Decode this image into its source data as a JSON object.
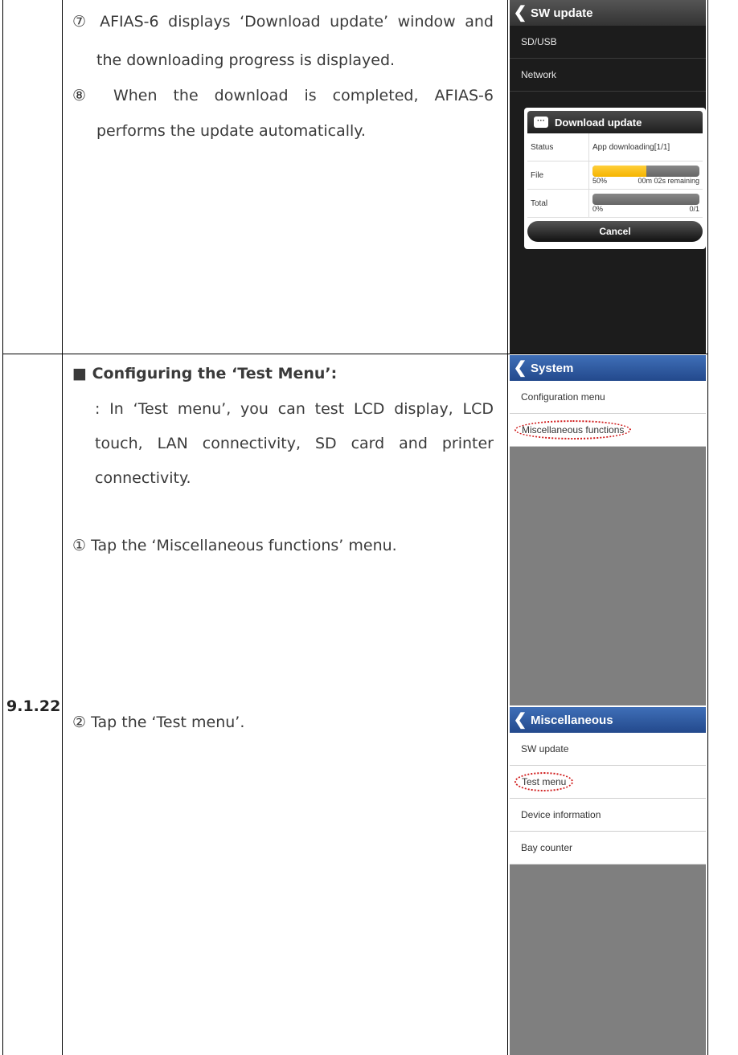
{
  "section_number": "9.1.22",
  "row1": {
    "step7_line1": "⑦ AFIAS-6 displays ‘Download update’ window and",
    "step7_line2": "the downloading progress is displayed.",
    "step8_line1": "⑧ When the download is completed, AFIAS-6",
    "step8_line2": "performs the update automatically."
  },
  "row2": {
    "heading": "■ Configuring the ‘Test Menu’:",
    "desc_line1": ": In ‘Test menu’, you can test LCD display, LCD",
    "desc_line2": "touch, LAN connectivity, SD card and printer",
    "desc_line3": "connectivity.",
    "step1": "① Tap the ‘Miscellaneous functions’ menu.",
    "step2": "② Tap the ‘Test menu’."
  },
  "screen_sw_update": {
    "title": "SW update",
    "items": [
      "SD/USB",
      "Network"
    ],
    "dialog": {
      "title": "Download update",
      "status_label": "Status",
      "status_value": "App downloading[1/1]",
      "file_label": "File",
      "file_percent": "50%",
      "file_remaining": "00m 02s remaining",
      "file_progress": 0.5,
      "total_label": "Total",
      "total_percent": "0%",
      "total_count": "0/1",
      "total_progress": 0.0,
      "cancel_label": "Cancel"
    }
  },
  "screen_system": {
    "title": "System",
    "items": [
      "Configuration menu",
      "Miscellaneous functions"
    ]
  },
  "screen_misc": {
    "title": "Miscellaneous",
    "items": [
      "SW update",
      "Test menu",
      "Device information",
      "Bay counter"
    ]
  },
  "colors": {
    "header_blue": "#2f5aa0",
    "progress_yellow": "#f5b400",
    "highlight_red": "#d01c1c"
  }
}
